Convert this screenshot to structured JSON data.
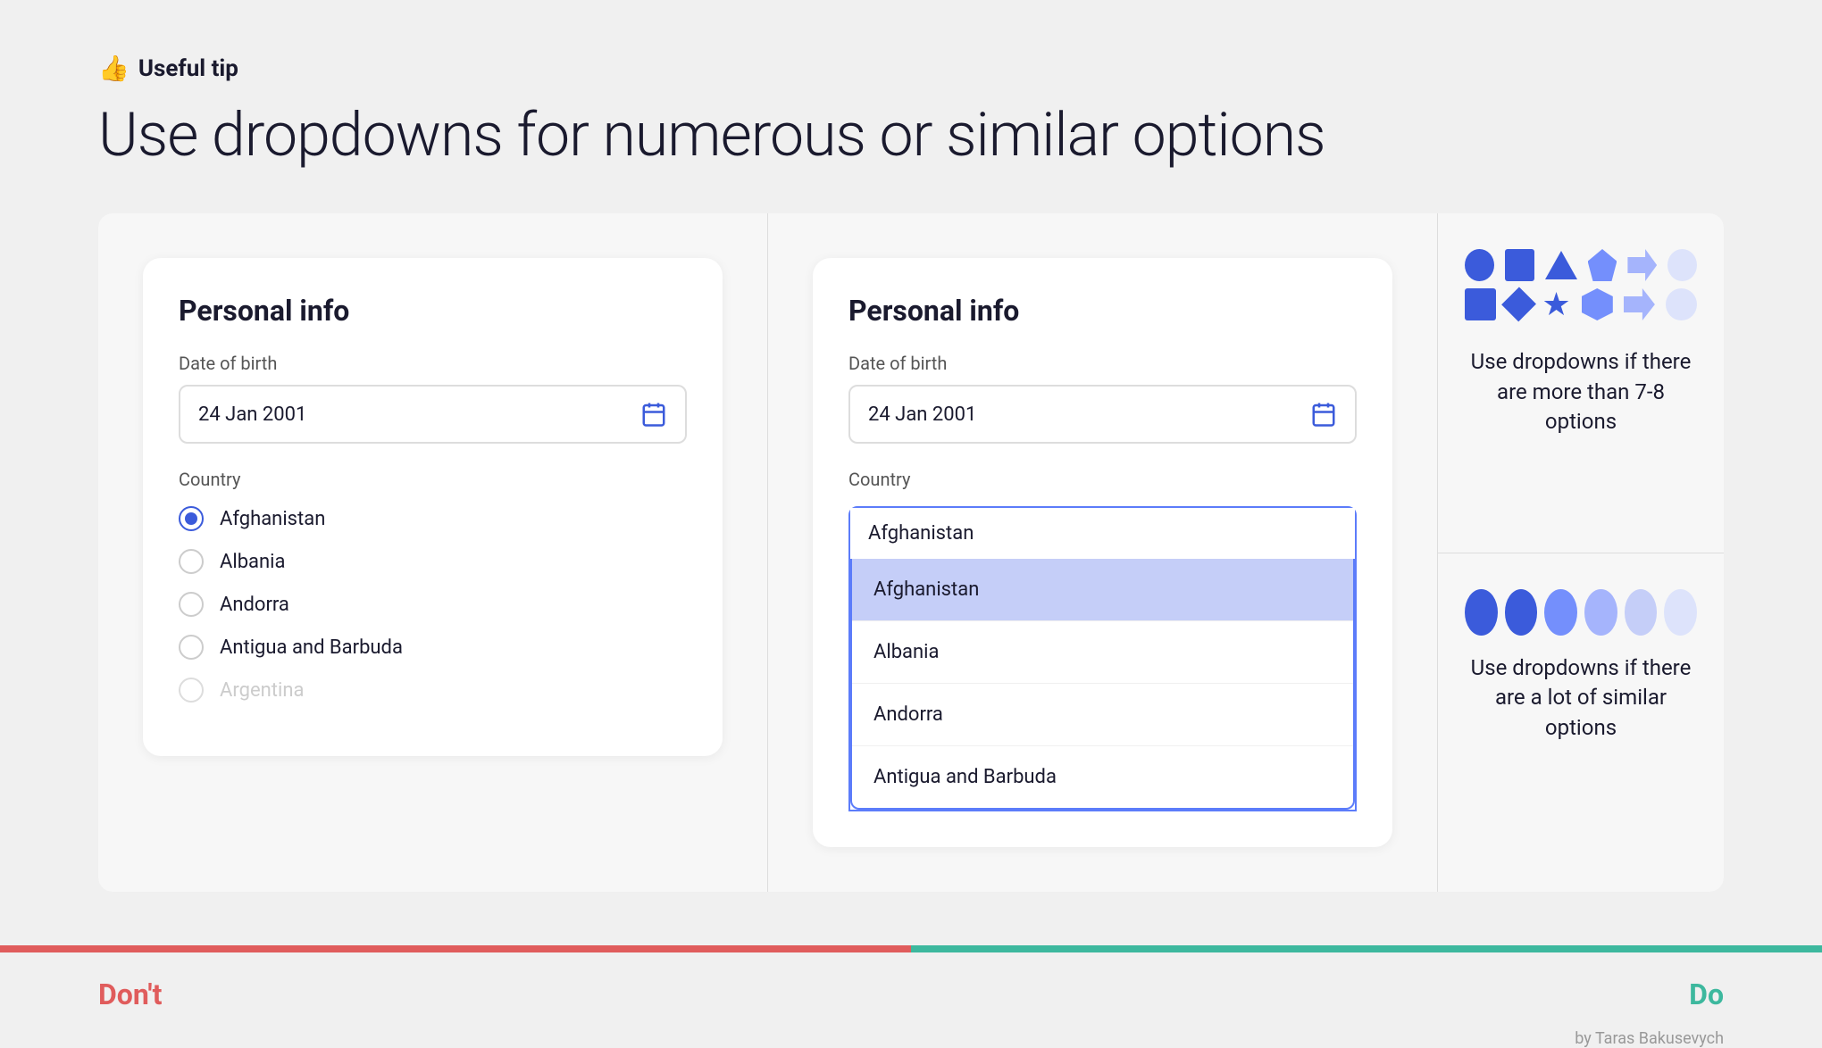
{
  "header": {
    "tip_label": "Useful tip",
    "main_title": "Use dropdowns for numerous or similar options",
    "thumb_icon": "👍"
  },
  "left_panel": {
    "card_title": "Personal info",
    "date_label": "Date of birth",
    "date_value": "24 Jan 2001",
    "country_label": "Country",
    "radio_options": [
      {
        "label": "Afghanistan",
        "selected": true,
        "faded": false
      },
      {
        "label": "Albania",
        "selected": false,
        "faded": false
      },
      {
        "label": "Andorra",
        "selected": false,
        "faded": false
      },
      {
        "label": "Antigua and Barbuda",
        "selected": false,
        "faded": false
      },
      {
        "label": "Argentina",
        "selected": false,
        "faded": true
      }
    ]
  },
  "middle_panel": {
    "card_title": "Personal info",
    "date_label": "Date of birth",
    "date_value": "24 Jan 2001",
    "country_label": "Country",
    "dropdown_selected": "Afghanistan",
    "dropdown_items": [
      {
        "label": "Afghanistan",
        "active": true
      },
      {
        "label": "Albania",
        "active": false
      },
      {
        "label": "Andorra",
        "active": false
      },
      {
        "label": "Antigua and Barbuda",
        "active": false
      }
    ]
  },
  "right_panel": {
    "top_text": "Use dropdowns if there are more than 7-8 options",
    "bottom_text": "Use dropdowns if there are a lot of similar options"
  },
  "bottom": {
    "dont_label": "Don't",
    "do_label": "Do",
    "attribution": "by Taras Bakusevych"
  },
  "colors": {
    "blue_full": "#3b5bdb",
    "blue_medium": "#748ffc",
    "blue_light": "#a5b4fc",
    "blue_lighter": "#c5cef8",
    "blue_lightest": "#dde3fb",
    "dont_color": "#e05c5c",
    "do_color": "#3db89e"
  }
}
